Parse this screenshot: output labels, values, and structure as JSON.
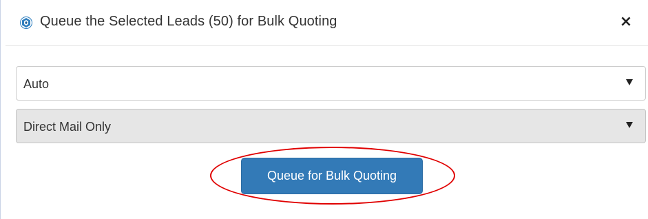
{
  "dialog": {
    "title": "Queue the Selected Leads (50) for Bulk Quoting",
    "close_label": "×",
    "icon": "app-logo-icon",
    "accent_color": "#2f7fbf"
  },
  "fields": {
    "line_select": {
      "value": "Auto"
    },
    "mail_select": {
      "value": "Direct Mail Only"
    }
  },
  "actions": {
    "queue_button_label": "Queue for Bulk Quoting",
    "button_color": "#337ab7"
  },
  "annotation": {
    "shape": "red-ellipse-highlight",
    "color": "#e00000"
  }
}
